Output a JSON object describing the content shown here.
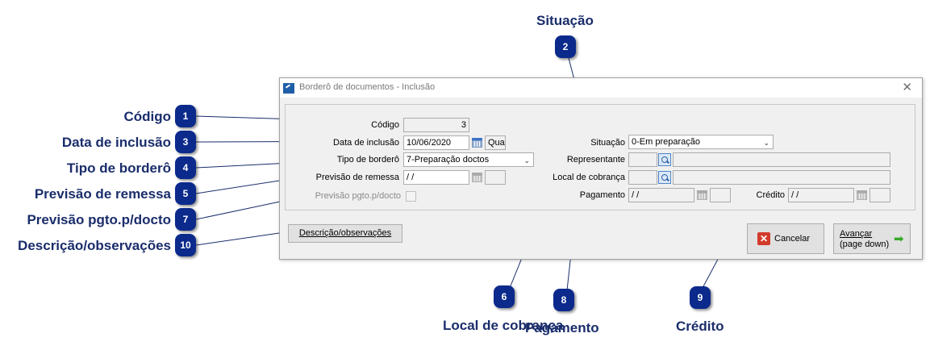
{
  "callouts": {
    "codigo": "Código",
    "data_inclusao": "Data de inclusão",
    "tipo_bordero": "Tipo de borderô",
    "previsao_remessa": "Previsão de remessa",
    "previsao_pgto": "Previsão pgto.p/docto",
    "descricao": "Descrição/observações",
    "situacao": "Situação",
    "local_cobranca": "Local de cobrança",
    "pagamento": "Pagamento",
    "credito": "Crédito"
  },
  "badges": {
    "b1": "1",
    "b2": "2",
    "b3": "3",
    "b4": "4",
    "b5": "5",
    "b6": "6",
    "b7": "7",
    "b8": "8",
    "b9": "9",
    "b10": "10"
  },
  "dialog": {
    "title": "Borderô de documentos - Inclusão",
    "close": "✕",
    "codigo": {
      "label": "Código",
      "value": "3"
    },
    "data_inclusao": {
      "label": "Data de inclusão",
      "value": "10/06/2020",
      "weekday": "Qua"
    },
    "tipo_bordero": {
      "label": "Tipo de borderô",
      "value": "7-Preparação doctos"
    },
    "previsao_remessa": {
      "label": "Previsão de remessa",
      "value": " / /"
    },
    "previsao_pgto": {
      "label": "Previsão pgto.p/docto"
    },
    "situacao": {
      "label": "Situação",
      "value": "0-Em preparação"
    },
    "representante": {
      "label": "Representante"
    },
    "local_cobranca": {
      "label": "Local de cobrança"
    },
    "pagamento": {
      "label": "Pagamento",
      "value": " / /"
    },
    "credito": {
      "label": "Crédito",
      "value": " / /"
    },
    "descricao_button": "Descrição/observações",
    "cancel_button": "Cancelar",
    "advance_button_line1": "Avançar",
    "advance_button_line2": "(page down)"
  },
  "icons": {
    "badge_color": "#0b2a8c",
    "callout_text_color": "#1a2d6b",
    "calendar": "calendar-icon",
    "lookup": "lookup-search-icon",
    "cancel": "cancel-x-icon",
    "advance": "green-arrow-right-icon"
  }
}
